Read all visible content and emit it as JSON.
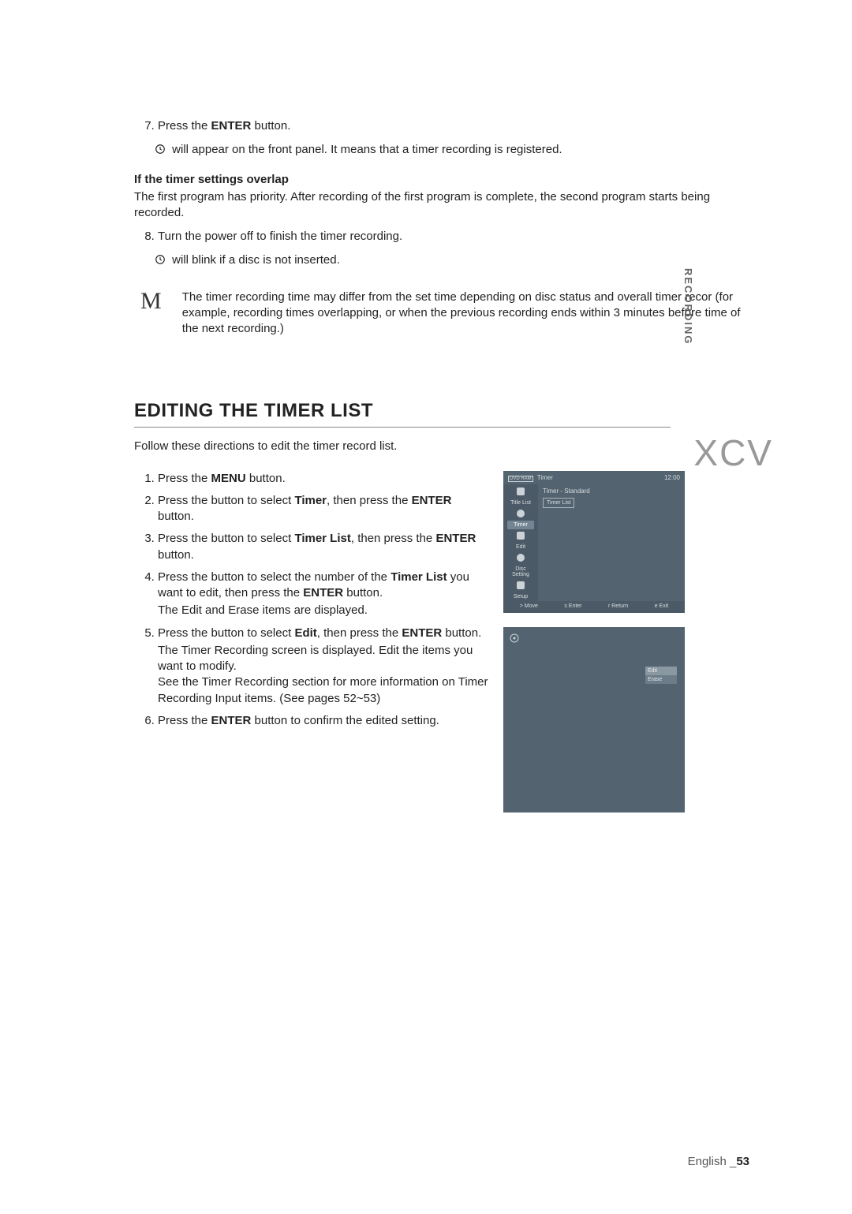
{
  "side_tab": "RECORDING",
  "list_a": {
    "start": 7,
    "items": [
      {
        "pre": "Press the ",
        "bold": "ENTER",
        "post": " button."
      }
    ],
    "sub1": " will appear on the front panel. It means that a timer recording is registered."
  },
  "overlap": {
    "heading": "If the timer settings overlap",
    "para": "The first program has priority. After recording of the first program is complete, the second program starts being recorded."
  },
  "list_b": {
    "start": 8,
    "items": [
      {
        "text": "Turn the power off to finish the timer recording."
      }
    ],
    "sub1": " will blink if a disc is not inserted."
  },
  "note": {
    "mark": "M",
    "text": "The timer recording time may differ from the set time depending on disc status and overall timer recor (for example, recording times overlapping, or when the previous recording ends within 3 minutes before time of the next recording.)"
  },
  "section_title": "EDITING THE TIMER LIST",
  "section_intro": "Follow these directions to edit the timer record list.",
  "watermark": "XCV",
  "steps": [
    {
      "parts": [
        "Press the ",
        {
          "b": "MENU"
        },
        " button."
      ]
    },
    {
      "parts": [
        "Press the        button to select ",
        {
          "b": "Timer"
        },
        ", then press the ",
        {
          "b": "ENTER"
        },
        " button."
      ]
    },
    {
      "parts": [
        "Press the        button to select ",
        {
          "b": "Timer List"
        },
        ", then press the ",
        {
          "b": "ENTER"
        },
        " button."
      ]
    },
    {
      "parts": [
        "Press the        button to select the number of the ",
        {
          "b": "Timer List"
        },
        " you want to edit, then press the ",
        {
          "b": "ENTER"
        },
        " button."
      ],
      "extra": "The Edit and Erase items are displayed."
    },
    {
      "parts": [
        "Press the        button to select ",
        {
          "b": "Edit"
        },
        ", then press the ",
        {
          "b": "ENTER"
        },
        " button."
      ],
      "extra": "The Timer Recording screen is displayed. Edit the items you want to modify.\nSee the Timer Recording section for more information on Timer Recording Input items. (See pages 52~53)"
    },
    {
      "parts": [
        "Press the ",
        {
          "b": "ENTER"
        },
        " button to confirm the edited setting."
      ]
    }
  ],
  "fig1": {
    "top_left_icon": "DVD RAM",
    "title": "Timer",
    "clock": "12:00",
    "side_items": [
      "Title List",
      "Timer",
      "Edit",
      "Disc Setting",
      "Setup"
    ],
    "body_label": "Timer - Standard",
    "body_box": "Timer List",
    "bottom": [
      "> Move",
      "s Enter",
      "r Return",
      "e Exit"
    ]
  },
  "fig2": {
    "menu": [
      "Edit",
      "Erase"
    ]
  },
  "footer": {
    "lang": "English _",
    "page": "53"
  }
}
